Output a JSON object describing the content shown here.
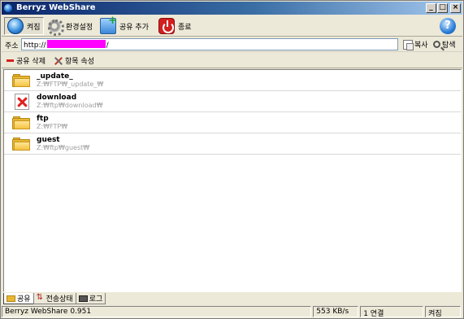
{
  "window": {
    "title": "Berryz WebShare",
    "controls": {
      "minimize": "_",
      "maximize": "□",
      "close": "×"
    }
  },
  "toolbar": {
    "power_on": "켜짐",
    "settings": "환경설정",
    "add_share": "공유 추가",
    "quit": "종료",
    "help": "?"
  },
  "address": {
    "label": "주소",
    "prefix": "http://",
    "suffix": "/",
    "copy": "복사",
    "browse": "탐색"
  },
  "actions": {
    "delete_share": "공유 삭제",
    "item_properties": "항목 속성"
  },
  "shares": [
    {
      "name": "_update_",
      "path": "Z:₩FTP₩_update_₩",
      "icon": "folder-icon"
    },
    {
      "name": "download",
      "path": "Z:₩ftp₩download₩",
      "icon": "error-icon"
    },
    {
      "name": "ftp",
      "path": "Z:₩FTP₩",
      "icon": "folder-icon"
    },
    {
      "name": "guest",
      "path": "Z:₩ftp₩guest₩",
      "icon": "folder-icon"
    }
  ],
  "tabs": [
    {
      "label": "공유",
      "active": true
    },
    {
      "label": "전송상태",
      "active": false
    },
    {
      "label": "로그",
      "active": false
    }
  ],
  "status": {
    "version": "Berryz WebShare 0.951",
    "speed": "553 KB/s",
    "connections": "1 연결",
    "state": "켜짐"
  },
  "colors": {
    "title_gradient_start": "#0a246a",
    "redaction": "#ff00ff",
    "error_red": "#e02020",
    "folder_yellow": "#f5c240"
  }
}
